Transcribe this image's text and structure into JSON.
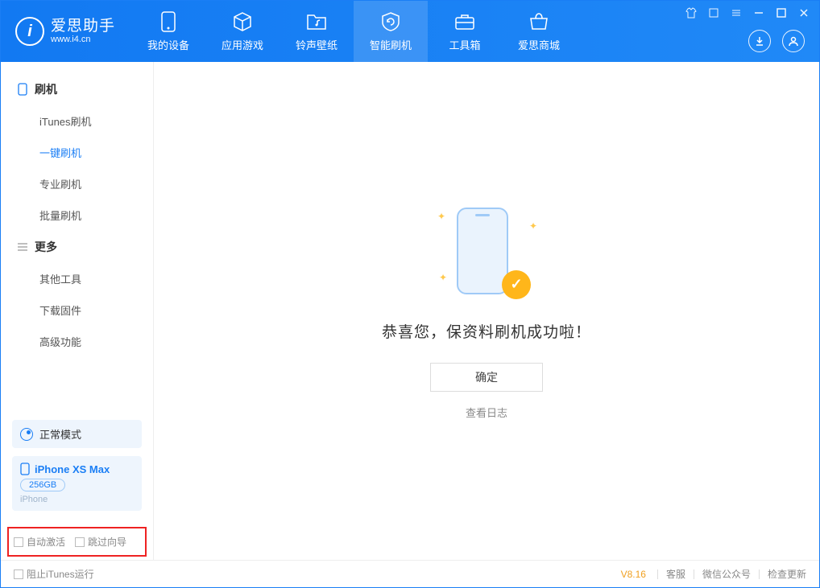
{
  "app": {
    "logo_title": "爱思助手",
    "logo_subtitle": "www.i4.cn"
  },
  "nav": {
    "tabs": [
      {
        "label": "我的设备",
        "active": false
      },
      {
        "label": "应用游戏",
        "active": false
      },
      {
        "label": "铃声壁纸",
        "active": false
      },
      {
        "label": "智能刷机",
        "active": true
      },
      {
        "label": "工具箱",
        "active": false
      },
      {
        "label": "爱思商城",
        "active": false
      }
    ]
  },
  "sidebar": {
    "section1_title": "刷机",
    "items1": [
      {
        "label": "iTunes刷机",
        "active": false
      },
      {
        "label": "一键刷机",
        "active": true
      },
      {
        "label": "专业刷机",
        "active": false
      },
      {
        "label": "批量刷机",
        "active": false
      }
    ],
    "section2_title": "更多",
    "items2": [
      {
        "label": "其他工具",
        "active": false
      },
      {
        "label": "下载固件",
        "active": false
      },
      {
        "label": "高级功能",
        "active": false
      }
    ],
    "mode_label": "正常模式",
    "device_name": "iPhone XS Max",
    "device_storage": "256GB",
    "device_type": "iPhone",
    "checkbox1_label": "自动激活",
    "checkbox2_label": "跳过向导"
  },
  "main": {
    "success_text": "恭喜您，保资料刷机成功啦！",
    "ok_button": "确定",
    "log_link": "查看日志"
  },
  "footer": {
    "block_itunes": "阻止iTunes运行",
    "version": "V8.16",
    "links": [
      "客服",
      "微信公众号",
      "检查更新"
    ]
  }
}
